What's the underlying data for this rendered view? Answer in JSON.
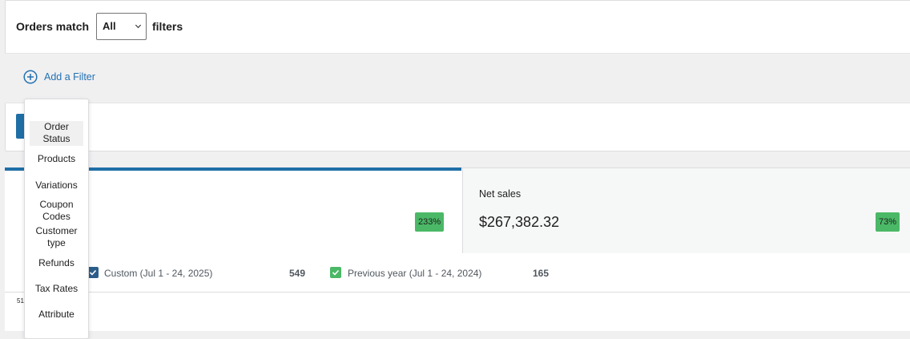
{
  "filters": {
    "match_prefix": "Orders match",
    "match_value": "All",
    "match_suffix": "filters",
    "add_filter_label": "Add a Filter"
  },
  "filter_menu": {
    "items": [
      "Order Status",
      "Products",
      "Variations",
      "Coupon Codes",
      "Customer type",
      "Refunds",
      "Tax Rates",
      "Attribute"
    ],
    "active_item": "Order Status"
  },
  "summary": {
    "left_badge": "233%",
    "net_sales_label": "Net sales",
    "net_sales_value": "$267,382.32",
    "net_sales_badge": "73%"
  },
  "legend": [
    {
      "label": "Custom (Jul 1 - 24, 2025)",
      "value": "549",
      "color": "#2b5d8a",
      "checked": true
    },
    {
      "label": "Previous year (Jul 1 - 24, 2024)",
      "value": "165",
      "color": "#4ab866",
      "checked": true
    }
  ],
  "chart": {
    "first_tick": "51"
  },
  "colors": {
    "accent": "#1f6fa6",
    "link": "#2271b1",
    "positive_badge": "#4ab866"
  }
}
